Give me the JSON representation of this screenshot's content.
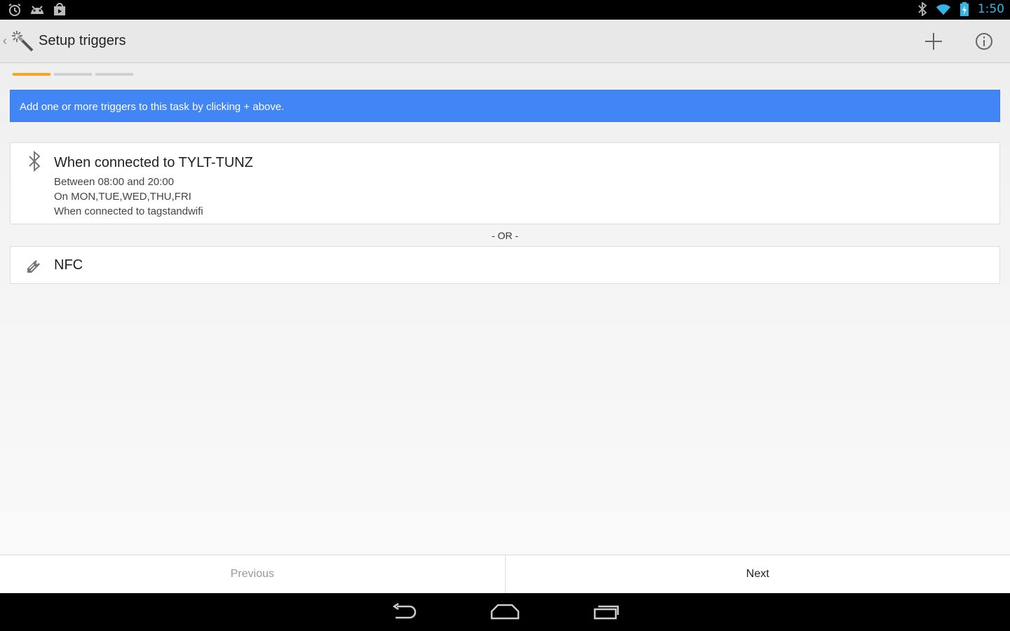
{
  "status_bar": {
    "left_icons": [
      "alarm-icon",
      "android-icon",
      "store-icon"
    ],
    "right_icons": [
      "bluetooth-icon",
      "wifi-icon",
      "battery-icon"
    ],
    "time": "1:50"
  },
  "action_bar": {
    "title": "Setup triggers",
    "actions": [
      "add-icon",
      "info-icon"
    ]
  },
  "progress": {
    "total_steps": 3,
    "current_step": 1,
    "accent": "#f5a623"
  },
  "banner": {
    "text": "Add one or more triggers to this task by clicking + above.",
    "color": "#4285f4"
  },
  "triggers": [
    {
      "icon": "bluetooth-icon",
      "title": "When connected to TYLT-TUNZ",
      "details": [
        "Between 08:00 and 20:00",
        "On MON,TUE,WED,THU,FRI",
        "When connected to tagstandwifi"
      ]
    },
    {
      "icon": "nfc-tag-icon",
      "title": "NFC",
      "details": []
    }
  ],
  "separator": "- OR -",
  "bottom_buttons": {
    "previous": "Previous",
    "next": "Next"
  },
  "nav_bar": [
    "back-icon",
    "home-icon",
    "recents-icon"
  ]
}
